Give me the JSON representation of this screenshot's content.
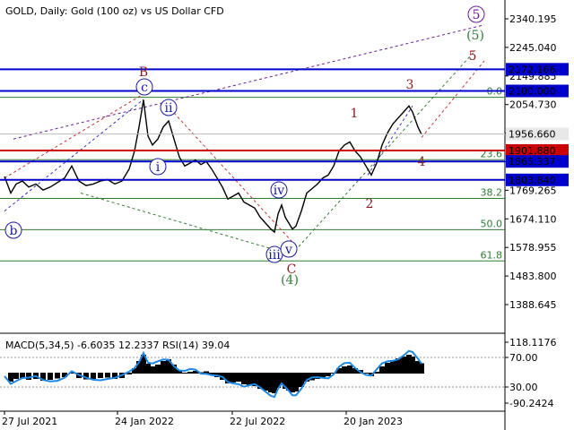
{
  "chart_data": {
    "type": "candlestick",
    "title": "GOLD, Daily:  Gold (100 oz) vs US Dollar CFD",
    "price_axis": {
      "ticks": [
        "2340.195",
        "2245.040",
        "2149.885",
        "2054.730",
        "1959.575",
        "1864.420",
        "1769.265",
        "1674.110",
        "1578.955",
        "1483.800",
        "1388.645"
      ],
      "ylim": [
        1340,
        2375
      ]
    },
    "time_axis": {
      "ticks": [
        "27 Jul 2021",
        "24 Jan 2022",
        "22 Jul 2022",
        "20 Jan 2023"
      ]
    },
    "levels": [
      {
        "name": "level-2172",
        "value": 2172.166,
        "label": "2172.166",
        "color": "#0000cc"
      },
      {
        "name": "level-2100",
        "value": 2100.0,
        "label": "2100.000",
        "color": "#0000cc"
      },
      {
        "name": "level-1901",
        "value": 1901.88,
        "label": "1901.880",
        "color": "#cc0000"
      },
      {
        "name": "level-1865",
        "value": 1865.337,
        "label": "1865.337",
        "color": "#0000cc"
      },
      {
        "name": "level-1803",
        "value": 1803.84,
        "label": "1803.840",
        "color": "#0000cc"
      }
    ],
    "current_price": {
      "value": 1956.66,
      "label": "1956.660"
    },
    "fibonacci": [
      {
        "label": "0.0",
        "value": 2079
      },
      {
        "label": "23.6",
        "value": 1871
      },
      {
        "label": "38.2",
        "value": 1742
      },
      {
        "label": "50.0",
        "value": 1638
      },
      {
        "label": "61.8",
        "value": 1534
      }
    ],
    "wave_labels": [
      {
        "text": "B",
        "color": "#8b1a1a",
        "circled": false
      },
      {
        "text": "c",
        "color": "#1a1aa0",
        "circled": true
      },
      {
        "text": "ii",
        "color": "#1a1aa0",
        "circled": true
      },
      {
        "text": "i",
        "color": "#1a1aa0",
        "circled": true
      },
      {
        "text": "b",
        "color": "#1a1aa0",
        "circled": true
      },
      {
        "text": "iv",
        "color": "#1a1aa0",
        "circled": true
      },
      {
        "text": "iii",
        "color": "#1a1aa0",
        "circled": true
      },
      {
        "text": "v",
        "color": "#1a1aa0",
        "circled": true
      },
      {
        "text": "C",
        "color": "#8b1a1a",
        "circled": false
      },
      {
        "text": "(4)",
        "color": "#2e7d32",
        "circled": false
      },
      {
        "text": "1",
        "color": "#8b1a1a",
        "circled": false
      },
      {
        "text": "2",
        "color": "#8b1a1a",
        "circled": false
      },
      {
        "text": "3",
        "color": "#8b1a1a",
        "circled": false
      },
      {
        "text": "4",
        "color": "#8b1a1a",
        "circled": false
      },
      {
        "text": "5",
        "color": "#8b1a1a",
        "circled": false
      },
      {
        "text": "(5)",
        "color": "#2e7d32",
        "circled": false
      },
      {
        "text": "5",
        "color": "#6a1b9a",
        "circled": true
      }
    ],
    "indicator": {
      "title": "MACD(5,34,5) -6.6035 12.2337 RSI(14) 39.04",
      "ticks": [
        "118.1176",
        "70.00",
        "30.00",
        "-90.2424"
      ]
    }
  }
}
